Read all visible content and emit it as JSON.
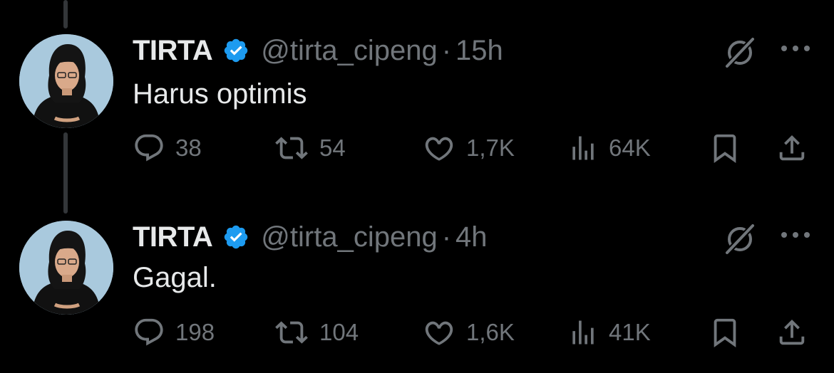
{
  "tweets": [
    {
      "author_name": "TIRTA",
      "handle": "@tirta_cipeng",
      "separator": "·",
      "time": "15h",
      "text": "Harus optimis",
      "replies": "38",
      "retweets": "54",
      "likes": "1,7K",
      "views": "64K"
    },
    {
      "author_name": "TIRTA",
      "handle": "@tirta_cipeng",
      "separator": "·",
      "time": "4h",
      "text": "Gagal.",
      "replies": "198",
      "retweets": "104",
      "likes": "1,6K",
      "views": "41K"
    }
  ],
  "colors": {
    "background": "#000000",
    "primary_text": "#e7e9ea",
    "secondary_text": "#71767b",
    "verified_badge": "#1d9bf0",
    "thread_line": "#333639"
  },
  "icons": [
    "verified-badge-icon",
    "grok-icon",
    "more-icon",
    "reply-icon",
    "retweet-icon",
    "like-icon",
    "views-icon",
    "bookmark-icon",
    "share-icon"
  ]
}
